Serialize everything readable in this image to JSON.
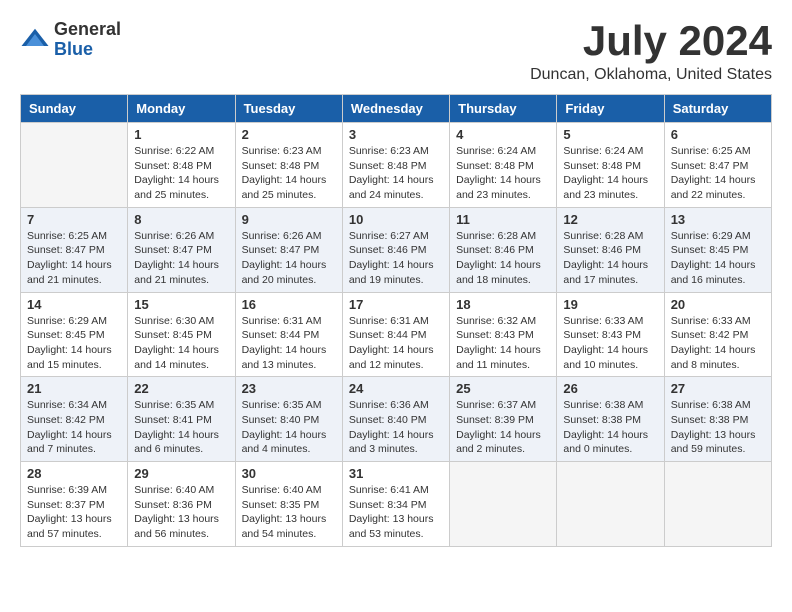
{
  "logo": {
    "general": "General",
    "blue": "Blue"
  },
  "header": {
    "month": "July 2024",
    "location": "Duncan, Oklahoma, United States"
  },
  "weekdays": [
    "Sunday",
    "Monday",
    "Tuesday",
    "Wednesday",
    "Thursday",
    "Friday",
    "Saturday"
  ],
  "weeks": [
    [
      {
        "day": "",
        "info": ""
      },
      {
        "day": "1",
        "info": "Sunrise: 6:22 AM\nSunset: 8:48 PM\nDaylight: 14 hours\nand 25 minutes."
      },
      {
        "day": "2",
        "info": "Sunrise: 6:23 AM\nSunset: 8:48 PM\nDaylight: 14 hours\nand 25 minutes."
      },
      {
        "day": "3",
        "info": "Sunrise: 6:23 AM\nSunset: 8:48 PM\nDaylight: 14 hours\nand 24 minutes."
      },
      {
        "day": "4",
        "info": "Sunrise: 6:24 AM\nSunset: 8:48 PM\nDaylight: 14 hours\nand 23 minutes."
      },
      {
        "day": "5",
        "info": "Sunrise: 6:24 AM\nSunset: 8:48 PM\nDaylight: 14 hours\nand 23 minutes."
      },
      {
        "day": "6",
        "info": "Sunrise: 6:25 AM\nSunset: 8:47 PM\nDaylight: 14 hours\nand 22 minutes."
      }
    ],
    [
      {
        "day": "7",
        "info": "Sunrise: 6:25 AM\nSunset: 8:47 PM\nDaylight: 14 hours\nand 21 minutes."
      },
      {
        "day": "8",
        "info": "Sunrise: 6:26 AM\nSunset: 8:47 PM\nDaylight: 14 hours\nand 21 minutes."
      },
      {
        "day": "9",
        "info": "Sunrise: 6:26 AM\nSunset: 8:47 PM\nDaylight: 14 hours\nand 20 minutes."
      },
      {
        "day": "10",
        "info": "Sunrise: 6:27 AM\nSunset: 8:46 PM\nDaylight: 14 hours\nand 19 minutes."
      },
      {
        "day": "11",
        "info": "Sunrise: 6:28 AM\nSunset: 8:46 PM\nDaylight: 14 hours\nand 18 minutes."
      },
      {
        "day": "12",
        "info": "Sunrise: 6:28 AM\nSunset: 8:46 PM\nDaylight: 14 hours\nand 17 minutes."
      },
      {
        "day": "13",
        "info": "Sunrise: 6:29 AM\nSunset: 8:45 PM\nDaylight: 14 hours\nand 16 minutes."
      }
    ],
    [
      {
        "day": "14",
        "info": "Sunrise: 6:29 AM\nSunset: 8:45 PM\nDaylight: 14 hours\nand 15 minutes."
      },
      {
        "day": "15",
        "info": "Sunrise: 6:30 AM\nSunset: 8:45 PM\nDaylight: 14 hours\nand 14 minutes."
      },
      {
        "day": "16",
        "info": "Sunrise: 6:31 AM\nSunset: 8:44 PM\nDaylight: 14 hours\nand 13 minutes."
      },
      {
        "day": "17",
        "info": "Sunrise: 6:31 AM\nSunset: 8:44 PM\nDaylight: 14 hours\nand 12 minutes."
      },
      {
        "day": "18",
        "info": "Sunrise: 6:32 AM\nSunset: 8:43 PM\nDaylight: 14 hours\nand 11 minutes."
      },
      {
        "day": "19",
        "info": "Sunrise: 6:33 AM\nSunset: 8:43 PM\nDaylight: 14 hours\nand 10 minutes."
      },
      {
        "day": "20",
        "info": "Sunrise: 6:33 AM\nSunset: 8:42 PM\nDaylight: 14 hours\nand 8 minutes."
      }
    ],
    [
      {
        "day": "21",
        "info": "Sunrise: 6:34 AM\nSunset: 8:42 PM\nDaylight: 14 hours\nand 7 minutes."
      },
      {
        "day": "22",
        "info": "Sunrise: 6:35 AM\nSunset: 8:41 PM\nDaylight: 14 hours\nand 6 minutes."
      },
      {
        "day": "23",
        "info": "Sunrise: 6:35 AM\nSunset: 8:40 PM\nDaylight: 14 hours\nand 4 minutes."
      },
      {
        "day": "24",
        "info": "Sunrise: 6:36 AM\nSunset: 8:40 PM\nDaylight: 14 hours\nand 3 minutes."
      },
      {
        "day": "25",
        "info": "Sunrise: 6:37 AM\nSunset: 8:39 PM\nDaylight: 14 hours\nand 2 minutes."
      },
      {
        "day": "26",
        "info": "Sunrise: 6:38 AM\nSunset: 8:38 PM\nDaylight: 14 hours\nand 0 minutes."
      },
      {
        "day": "27",
        "info": "Sunrise: 6:38 AM\nSunset: 8:38 PM\nDaylight: 13 hours\nand 59 minutes."
      }
    ],
    [
      {
        "day": "28",
        "info": "Sunrise: 6:39 AM\nSunset: 8:37 PM\nDaylight: 13 hours\nand 57 minutes."
      },
      {
        "day": "29",
        "info": "Sunrise: 6:40 AM\nSunset: 8:36 PM\nDaylight: 13 hours\nand 56 minutes."
      },
      {
        "day": "30",
        "info": "Sunrise: 6:40 AM\nSunset: 8:35 PM\nDaylight: 13 hours\nand 54 minutes."
      },
      {
        "day": "31",
        "info": "Sunrise: 6:41 AM\nSunset: 8:34 PM\nDaylight: 13 hours\nand 53 minutes."
      },
      {
        "day": "",
        "info": ""
      },
      {
        "day": "",
        "info": ""
      },
      {
        "day": "",
        "info": ""
      }
    ]
  ]
}
